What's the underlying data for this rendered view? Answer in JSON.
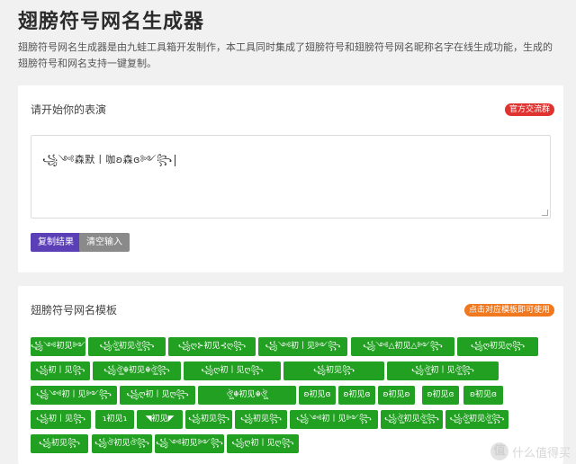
{
  "header": {
    "title": "翅膀符号网名生成器",
    "intro": "翅膀符号网名生成器是由九蛙工具箱开发制作，本工具同时集成了翅膀符号和翅膀符号网名昵称名字在线生成功能，生成的翅膀符号和网名支持一键复制。"
  },
  "editor": {
    "title": "请开始你的表演",
    "badge": "官方交流群",
    "value": "꧁༺森默丨咖ʚ森ɞ༻꧂",
    "copy_label": "复制结果",
    "clear_label": "清空输入"
  },
  "templates": {
    "title": "翅膀符号网名模板",
    "badge": "点击对应模板即可使用",
    "items": [
      {
        "label": "꧁༺初见༻꧂"
      },
      {
        "label": "꧁ঔৣ初见ঔৣ꧂"
      },
      {
        "label": "꧁ღ⊱初见⊰ღ꧂"
      },
      {
        "label": "꧁༺初丨见༻꧂"
      },
      {
        "label": "꧁༺△初见△༻꧂"
      },
      {
        "label": "꧁ღ初见ღ꧂"
      },
      {
        "label": "꧁初丨见꧂"
      },
      {
        "label": "꧁ঔৣ☬初见☬ঔৣ꧂"
      },
      {
        "label": "꧁ღ初丨见ღ꧂"
      },
      {
        "label": "꧁初见꧂"
      },
      {
        "label": "꧁ঔৣ初丨见ঔৣ꧂"
      },
      {
        "label": "꧁༺初丨见༻꧂"
      },
      {
        "label": "꧁ღ初丨见ღ꧂"
      },
      {
        "label": "ঔৣ☬初见☬ঔৣ"
      },
      {
        "label": "ʚ初见ɞ"
      },
      {
        "label": "ʚ初见ɞ"
      },
      {
        "label": "ʚ初见ʚ"
      },
      {
        "label": "ʚ初见ɞ"
      },
      {
        "label": "ʚ初见ɞ"
      },
      {
        "label": "꧁初丨见꧂"
      },
      {
        "label": "ɿ初见ɿ"
      },
      {
        "label": "◥初见◤"
      },
      {
        "label": "꧁初见꧂"
      },
      {
        "label": "꧁初见꧂"
      },
      {
        "label": "꧁༺初丨见༻꧂"
      },
      {
        "label": "꧁ঔৣ初见ঔৣ꧂"
      },
      {
        "label": "꧁ঔৣ初见ঔৣ꧂"
      },
      {
        "label": "꧁初见꧂"
      },
      {
        "label": "꧁ঔ初见ঔ꧂"
      },
      {
        "label": "꧁༺初见༻꧂"
      },
      {
        "label": "꧁ღ初丨见ღ꧂"
      }
    ]
  },
  "watermark": {
    "logo": "值",
    "text": "什么值得买"
  },
  "colors": {
    "template_green": "#21a021",
    "copy_purple": "#5b3fb7",
    "clear_gray": "#8a8a8a",
    "badge_red": "#e0322f",
    "badge_orange": "#f0781e"
  }
}
